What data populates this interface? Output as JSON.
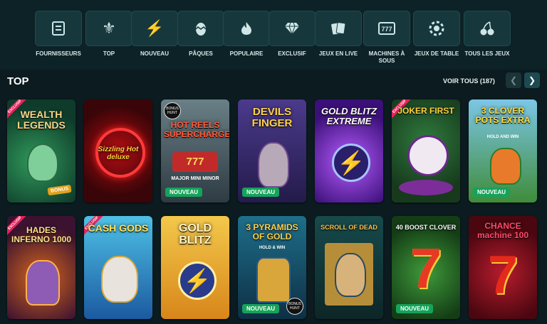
{
  "categories": [
    {
      "label": "FOURNISSEURS",
      "icon": "provider-icon"
    },
    {
      "label": "TOP",
      "icon": "crown-icon"
    },
    {
      "label": "NOUVEAU",
      "icon": "lightning-icon"
    },
    {
      "label": "PÂQUES",
      "icon": "easter-egg-icon"
    },
    {
      "label": "POPULAIRE",
      "icon": "flame-icon"
    },
    {
      "label": "EXCLUSIF",
      "icon": "diamond-icon"
    },
    {
      "label": "JEUX EN LIVE",
      "icon": "cards-icon"
    },
    {
      "label": "MACHINES À SOUS",
      "icon": "slot-machine-icon"
    },
    {
      "label": "JEUX DE TABLE",
      "icon": "chip-icon"
    },
    {
      "label": "TOUS LES JEUX",
      "icon": "cherries-icon"
    }
  ],
  "section": {
    "title": "TOP",
    "see_all": "VOIR TOUS (187)"
  },
  "games": [
    {
      "title": "WEALTH LEGENDS",
      "badge": "",
      "ribbon": "EXCLUSIF",
      "extra": "BONUS"
    },
    {
      "title": "Sizzling Hot deluxe",
      "badge": "",
      "ribbon": "",
      "extra": ""
    },
    {
      "title": "HOT REELS SUPERCHARGED",
      "badge": "NOUVEAU",
      "ribbon": "",
      "extra": "MAJOR MINI MINOR"
    },
    {
      "title": "DEVILS FINGER",
      "badge": "NOUVEAU",
      "ribbon": "",
      "extra": ""
    },
    {
      "title": "GOLD BLITZ EXTREME",
      "badge": "",
      "ribbon": "",
      "extra": ""
    },
    {
      "title": "JOKER FIRST",
      "badge": "",
      "ribbon": "EXCLUSIF",
      "extra": ""
    },
    {
      "title": "3 CLOVER POTS EXTRA",
      "badge": "NOUVEAU",
      "ribbon": "",
      "extra": "HOLD AND WIN"
    },
    {
      "title": "HADES INFERNO 1000",
      "badge": "",
      "ribbon": "EXCLUSIF",
      "extra": ""
    },
    {
      "title": "CASH GODS",
      "badge": "",
      "ribbon": "EXCLUSIF",
      "extra": ""
    },
    {
      "title": "GOLD BLITZ",
      "badge": "",
      "ribbon": "",
      "extra": ""
    },
    {
      "title": "3 PYRAMIDS OF GOLD",
      "badge": "NOUVEAU",
      "ribbon": "",
      "extra": "HOLD & WIN"
    },
    {
      "title": "SCROLL OF DEAD",
      "badge": "",
      "ribbon": "",
      "extra": ""
    },
    {
      "title": "40 BOOST CLOVER",
      "badge": "NOUVEAU",
      "ribbon": "",
      "extra": ""
    },
    {
      "title": "CHANCE machine 100",
      "badge": "",
      "ribbon": "",
      "extra": ""
    }
  ],
  "colors": {
    "background": "#0b1b1f",
    "tile": "#16383d",
    "new_badge": "#15a35a"
  }
}
